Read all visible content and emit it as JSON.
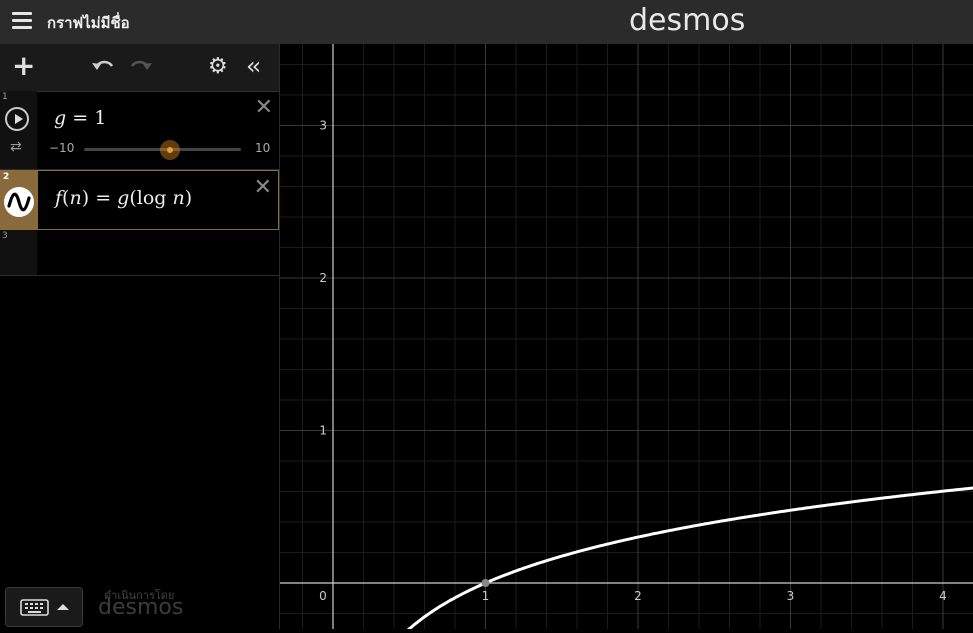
{
  "header": {
    "graph_title": "กราฟไม่มีชื่อ",
    "brand": "desmos"
  },
  "icons": {
    "menu": "hamburger-icon",
    "add": "plus-icon",
    "undo": "undo-icon",
    "redo": "redo-icon",
    "settings": "gear-icon",
    "collapse": "double-chevron-left-icon",
    "play": "play-icon",
    "loop": "loop-icon",
    "graph_style": "wave-icon",
    "close": "close-icon",
    "keyboard": "keyboard-icon"
  },
  "expressions": [
    {
      "index": "1",
      "variable": "g",
      "value": "1",
      "slider": {
        "min": "−10",
        "max": "10",
        "current": 1,
        "range": [
          -10,
          10
        ]
      }
    },
    {
      "index": "2",
      "lhs_fn": "f",
      "lhs_arg": "n",
      "rhs_fn": "g",
      "rhs_op": "log",
      "rhs_arg": "n"
    },
    {
      "index": "3"
    }
  ],
  "footer": {
    "powered_by": "ดำเนินการโดย",
    "powered_brand": "desmos"
  },
  "colors": {
    "accent": "#8a6a3d",
    "slider_thumb": "#f29b22",
    "curve": "#ffffff",
    "background": "#000000"
  },
  "chart_data": {
    "type": "line",
    "x_ticks": [
      "0",
      "1",
      "2",
      "3",
      "4"
    ],
    "y_ticks": [
      "1",
      "2",
      "3"
    ],
    "xlim": [
      -0.3,
      4.2
    ],
    "ylim": [
      -0.3,
      3.5
    ],
    "grid": true,
    "series": [
      {
        "function": "log10(x)",
        "x": [
          0.5,
          0.6,
          0.8,
          1,
          1.5,
          2,
          2.5,
          3,
          3.5,
          4,
          4.2
        ],
        "y": [
          -0.301,
          -0.222,
          -0.097,
          0,
          0.176,
          0.301,
          0.398,
          0.477,
          0.544,
          0.602,
          0.623
        ]
      }
    ],
    "points": [
      {
        "x": 1,
        "y": 0
      }
    ]
  }
}
